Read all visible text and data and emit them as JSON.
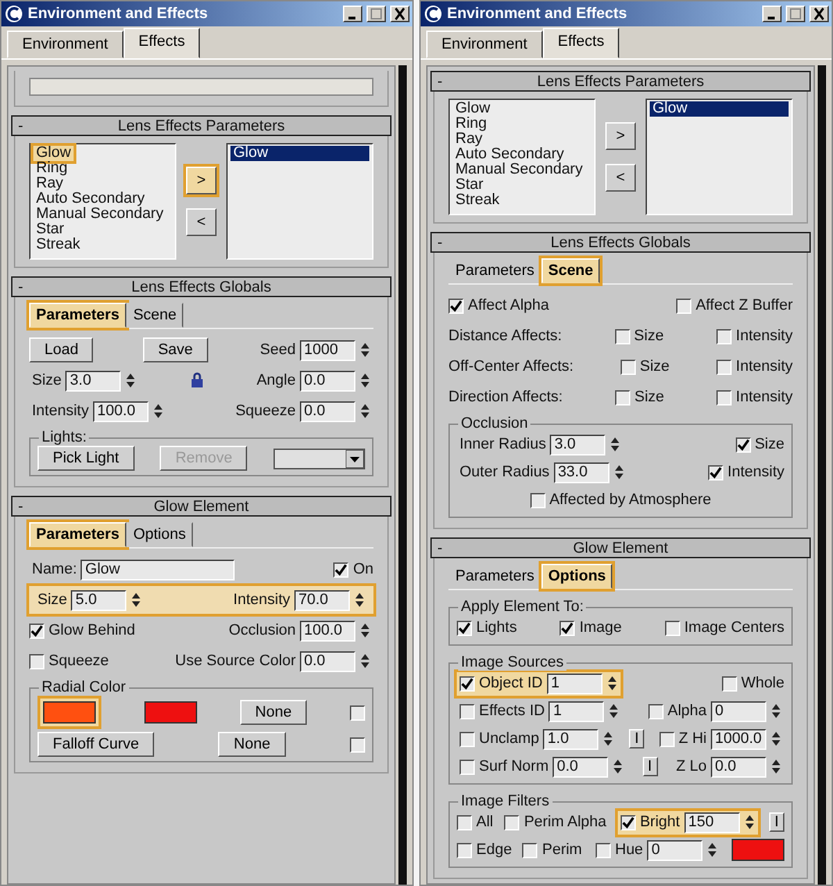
{
  "windows": [
    {
      "title": "Environment and Effects",
      "tabs": [
        {
          "label": "Environment",
          "selected": false
        },
        {
          "label": "Effects",
          "selected": true
        }
      ],
      "rollouts": [
        {
          "rows": [
            {
              "items": [
                {
                  "kind": "blank-field"
                }
              ]
            }
          ]
        },
        {
          "toggle": "-",
          "title": "Lens Effects Parameters",
          "rows": [
            {
              "items": [
                {
                  "kind": "list-pair",
                  "available": [
                    {
                      "label": "Glow",
                      "highlighted": true
                    },
                    {
                      "label": "Ring",
                      "highlighted": false
                    },
                    {
                      "label": "Ray",
                      "highlighted": false
                    },
                    {
                      "label": "Auto Secondary",
                      "highlighted": false
                    },
                    {
                      "label": "Manual Secondary",
                      "highlighted": false
                    },
                    {
                      "label": "Star",
                      "highlighted": false
                    },
                    {
                      "label": "Streak",
                      "highlighted": false
                    }
                  ],
                  "chosen": [
                    {
                      "label": "Glow",
                      "selected": true
                    }
                  ],
                  "add_button": {
                    "label": ">",
                    "highlighted": true
                  },
                  "remove_button": {
                    "label": "<",
                    "highlighted": false
                  }
                }
              ]
            }
          ]
        },
        {
          "toggle": "-",
          "title": "Lens Effects Globals",
          "subtabs": [
            {
              "label": "Parameters",
              "selected": true,
              "highlighted": true
            },
            {
              "label": "Scene",
              "selected": false,
              "highlighted": false
            }
          ],
          "rows": [
            {
              "items": [
                {
                  "kind": "button",
                  "label": "Load"
                },
                {
                  "kind": "button",
                  "label": "Save"
                },
                {
                  "kind": "spinner",
                  "label": "Seed",
                  "value": "1000"
                }
              ]
            },
            {
              "items": [
                {
                  "kind": "spinner",
                  "label": "Size",
                  "value": "3.0"
                },
                {
                  "kind": "lock"
                },
                {
                  "kind": "spinner",
                  "label": "Angle",
                  "value": "0.0"
                }
              ]
            },
            {
              "items": [
                {
                  "kind": "spinner",
                  "label": "Intensity",
                  "value": "100.0"
                },
                {
                  "kind": "spinner",
                  "label": "Squeeze",
                  "value": "0.0"
                }
              ]
            },
            {
              "items": [
                {
                  "kind": "group",
                  "title": "Lights:",
                  "rows": [
                    {
                      "items": [
                        {
                          "kind": "button",
                          "label": "Pick Light",
                          "disabled": false
                        },
                        {
                          "kind": "button",
                          "label": "Remove",
                          "disabled": true
                        },
                        {
                          "kind": "dropdown"
                        }
                      ]
                    }
                  ]
                }
              ]
            }
          ]
        },
        {
          "toggle": "-",
          "title": "Glow Element",
          "subtabs": [
            {
              "label": "Parameters",
              "selected": true,
              "highlighted": true
            },
            {
              "label": "Options",
              "selected": false,
              "highlighted": false
            }
          ],
          "rows": [
            {
              "items": [
                {
                  "kind": "text-field",
                  "label": "Name:",
                  "value": "Glow"
                },
                {
                  "kind": "checkbox",
                  "label": "On",
                  "checked": true
                }
              ]
            },
            {
              "highlighted": true,
              "items": [
                {
                  "kind": "spinner",
                  "label": "Size",
                  "value": "5.0"
                },
                {
                  "kind": "spinner",
                  "label": "Intensity",
                  "value": "70.0"
                }
              ]
            },
            {
              "items": [
                {
                  "kind": "checkbox",
                  "label": "Glow Behind",
                  "checked": true
                },
                {
                  "kind": "spinner",
                  "label": "Occlusion",
                  "value": "100.0"
                }
              ]
            },
            {
              "items": [
                {
                  "kind": "checkbox",
                  "label": "Squeeze",
                  "checked": false
                },
                {
                  "kind": "spinner",
                  "label": "Use Source Color",
                  "value": "0.0"
                }
              ]
            },
            {
              "items": [
                {
                  "kind": "group",
                  "title": "Radial Color",
                  "rows": [
                    {
                      "items": [
                        {
                          "kind": "swatch",
                          "color": "#ff5010",
                          "highlighted": true
                        },
                        {
                          "kind": "swatch",
                          "color": "#ee1010"
                        },
                        {
                          "kind": "button",
                          "label": "None"
                        },
                        {
                          "kind": "checkbox",
                          "checked": false
                        }
                      ]
                    },
                    {
                      "items": [
                        {
                          "kind": "button",
                          "label": "Falloff Curve"
                        },
                        {
                          "kind": "button",
                          "label": "None"
                        },
                        {
                          "kind": "checkbox",
                          "checked": false
                        }
                      ]
                    }
                  ]
                }
              ]
            }
          ]
        }
      ]
    },
    {
      "title": "Environment and Effects",
      "tabs": [
        {
          "label": "Environment",
          "selected": false
        },
        {
          "label": "Effects",
          "selected": true
        }
      ],
      "rollouts": [
        {
          "toggle": "-",
          "title": "Lens Effects Parameters",
          "rows": [
            {
              "items": [
                {
                  "kind": "list-pair",
                  "available": [
                    {
                      "label": "Glow",
                      "highlighted": false
                    },
                    {
                      "label": "Ring",
                      "highlighted": false
                    },
                    {
                      "label": "Ray",
                      "highlighted": false
                    },
                    {
                      "label": "Auto Secondary",
                      "highlighted": false
                    },
                    {
                      "label": "Manual Secondary",
                      "highlighted": false
                    },
                    {
                      "label": "Star",
                      "highlighted": false
                    },
                    {
                      "label": "Streak",
                      "highlighted": false
                    }
                  ],
                  "chosen": [
                    {
                      "label": "Glow",
                      "selected": true
                    }
                  ],
                  "add_button": {
                    "label": ">",
                    "highlighted": false
                  },
                  "remove_button": {
                    "label": "<",
                    "highlighted": false
                  }
                }
              ]
            }
          ]
        },
        {
          "toggle": "-",
          "title": "Lens Effects Globals",
          "subtabs": [
            {
              "label": "Parameters",
              "selected": false,
              "highlighted": false
            },
            {
              "label": "Scene",
              "selected": true,
              "highlighted": true
            }
          ],
          "rows": [
            {
              "items": [
                {
                  "kind": "checkbox",
                  "label": "Affect Alpha",
                  "checked": true
                },
                {
                  "kind": "checkbox",
                  "label": "Affect Z Buffer",
                  "checked": false
                }
              ]
            },
            {
              "items": [
                {
                  "kind": "text",
                  "label": "Distance Affects:"
                },
                {
                  "kind": "checkbox",
                  "label": "Size",
                  "checked": false
                },
                {
                  "kind": "checkbox",
                  "label": "Intensity",
                  "checked": false
                }
              ]
            },
            {
              "items": [
                {
                  "kind": "text",
                  "label": "Off-Center Affects:"
                },
                {
                  "kind": "checkbox",
                  "label": "Size",
                  "checked": false
                },
                {
                  "kind": "checkbox",
                  "label": "Intensity",
                  "checked": false
                }
              ]
            },
            {
              "items": [
                {
                  "kind": "text",
                  "label": "Direction Affects:"
                },
                {
                  "kind": "checkbox",
                  "label": "Size",
                  "checked": false
                },
                {
                  "kind": "checkbox",
                  "label": "Intensity",
                  "checked": false
                }
              ]
            },
            {
              "items": [
                {
                  "kind": "group",
                  "title": "Occlusion",
                  "rows": [
                    {
                      "items": [
                        {
                          "kind": "spinner",
                          "label": "Inner Radius",
                          "value": "3.0"
                        },
                        {
                          "kind": "checkbox",
                          "label": "Size",
                          "checked": true
                        }
                      ]
                    },
                    {
                      "items": [
                        {
                          "kind": "spinner",
                          "label": "Outer Radius",
                          "value": "33.0"
                        },
                        {
                          "kind": "checkbox",
                          "label": "Intensity",
                          "checked": true
                        }
                      ]
                    },
                    {
                      "items": [
                        {
                          "kind": "checkbox",
                          "label": "Affected by Atmosphere",
                          "checked": false
                        }
                      ]
                    }
                  ]
                }
              ]
            }
          ]
        },
        {
          "toggle": "-",
          "title": "Glow Element",
          "subtabs": [
            {
              "label": "Parameters",
              "selected": false,
              "highlighted": false
            },
            {
              "label": "Options",
              "selected": true,
              "highlighted": true
            }
          ],
          "rows": [
            {
              "items": [
                {
                  "kind": "group",
                  "title": "Apply Element To:",
                  "rows": [
                    {
                      "items": [
                        {
                          "kind": "checkbox",
                          "label": "Lights",
                          "checked": true
                        },
                        {
                          "kind": "checkbox",
                          "label": "Image",
                          "checked": true
                        },
                        {
                          "kind": "checkbox",
                          "label": "Image Centers",
                          "checked": false
                        }
                      ]
                    }
                  ]
                }
              ]
            },
            {
              "items": [
                {
                  "kind": "group",
                  "title": "Image Sources",
                  "rows": [
                    {
                      "items": [
                        {
                          "kind": "spinner",
                          "checked": true,
                          "label": "Object ID",
                          "value": "1",
                          "highlighted": true
                        },
                        {
                          "kind": "checkbox",
                          "label": "Whole",
                          "checked": false
                        }
                      ]
                    },
                    {
                      "items": [
                        {
                          "kind": "spinner",
                          "checked": false,
                          "label": "Effects ID",
                          "value": "1"
                        },
                        {
                          "kind": "spinner",
                          "checked": false,
                          "label": "Alpha",
                          "value": "0"
                        }
                      ]
                    },
                    {
                      "items": [
                        {
                          "kind": "spinner",
                          "checked": false,
                          "label": "Unclamp",
                          "value": "1.0"
                        },
                        {
                          "kind": "small-button",
                          "label": "I"
                        },
                        {
                          "kind": "spinner",
                          "checked": false,
                          "label": "Z Hi",
                          "value": "1000.0"
                        }
                      ]
                    },
                    {
                      "items": [
                        {
                          "kind": "spinner",
                          "checked": false,
                          "label": "Surf Norm",
                          "value": "0.0"
                        },
                        {
                          "kind": "small-button",
                          "label": "I"
                        },
                        {
                          "kind": "spinner",
                          "label": "Z Lo",
                          "value": "0.0"
                        }
                      ]
                    }
                  ]
                }
              ]
            },
            {
              "items": [
                {
                  "kind": "group",
                  "title": "Image Filters",
                  "rows": [
                    {
                      "items": [
                        {
                          "kind": "checkbox",
                          "label": "All",
                          "checked": false
                        },
                        {
                          "kind": "checkbox",
                          "label": "Perim Alpha",
                          "checked": false
                        },
                        {
                          "kind": "spinner",
                          "checked": true,
                          "label": "Bright",
                          "value": "150",
                          "highlighted": true
                        },
                        {
                          "kind": "small-button",
                          "label": "I"
                        }
                      ]
                    },
                    {
                      "items": [
                        {
                          "kind": "checkbox",
                          "label": "Edge",
                          "checked": false
                        },
                        {
                          "kind": "checkbox",
                          "label": "Perim",
                          "checked": false
                        },
                        {
                          "kind": "spinner",
                          "checked": false,
                          "label": "Hue",
                          "value": "0"
                        },
                        {
                          "kind": "swatch",
                          "color": "#ee1010"
                        }
                      ]
                    }
                  ]
                }
              ]
            }
          ]
        }
      ]
    }
  ]
}
